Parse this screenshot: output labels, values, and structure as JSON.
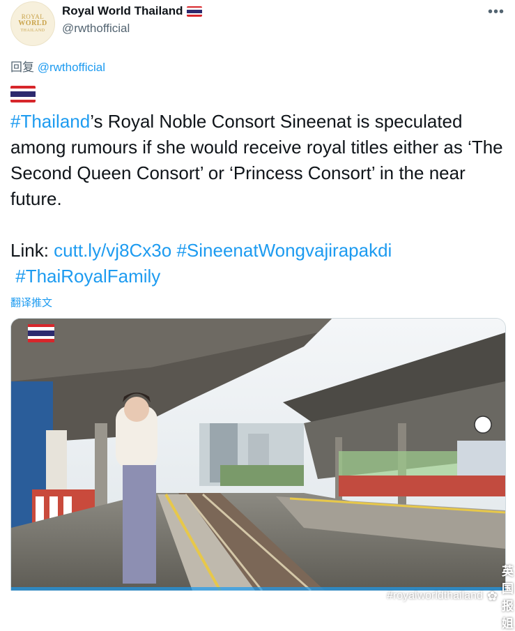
{
  "account": {
    "display_name": "Royal World Thailand",
    "handle": "@rwthofficial",
    "avatar_text": [
      "ROYAL",
      "WORLD",
      "THAILAND"
    ]
  },
  "menu_icon": "more-dots-icon",
  "more_label": "•••",
  "reply": {
    "prefix": "回复",
    "mention": "@rwthofficial"
  },
  "tweet": {
    "hashtag_thailand": "#Thailand",
    "text_main": "’s Royal Noble Consort Sineenat is speculated among rumours if she would receive royal titles either as ‘The Second Queen Consort’ or ‘Princess Consort’ in the near future.",
    "link_label": "Link: ",
    "link_url": "cutt.ly/vj8Cx3o",
    "hashtag_sineenat": "#SineenatWongvajirapakdi",
    "hashtag_family": "#ThaiRoyalFamily"
  },
  "translate_label": "翻译推文",
  "watermark": {
    "handle": "#royalworldthailand",
    "brand": "英国报姐"
  },
  "colors": {
    "link": "#1d9bf0",
    "secondary_text": "#536471",
    "flag_red": "#d7262b",
    "flag_blue": "#2d2a6e",
    "flag_white": "#ffffff"
  }
}
